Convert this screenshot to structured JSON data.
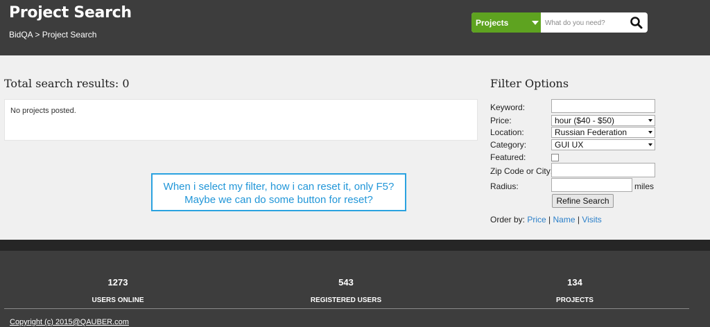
{
  "header": {
    "title": "Project Search",
    "breadcrumb": {
      "home": "BidQA",
      "separator": ">",
      "current": "Project Search"
    }
  },
  "search": {
    "category": "Projects",
    "placeholder": "What do you need?",
    "accent_color": "#5ea320",
    "icon": "search-icon"
  },
  "results": {
    "title": "Total search results: 0",
    "empty_message": "No projects posted."
  },
  "comment": {
    "text": "When i select my filter, how i can reset it, only F5? Maybe we can do some button for reset?",
    "border_color": "#2aa2e0"
  },
  "filter": {
    "title": "Filter Options",
    "keyword": {
      "label": "Keyword:",
      "value": ""
    },
    "price": {
      "label": "Price:",
      "value": "hour ($40 - $50)"
    },
    "location": {
      "label": "Location:",
      "value": "Russian Federation"
    },
    "category": {
      "label": "Category:",
      "value": "GUI UX"
    },
    "featured": {
      "label": "Featured:",
      "checked": false
    },
    "zip": {
      "label": "Zip Code or City:",
      "value": ""
    },
    "radius": {
      "label": "Radius:",
      "value": "",
      "unit": "miles"
    },
    "refine_label": "Refine Search",
    "order_by": {
      "label": "Order by:",
      "options": [
        "Price",
        "Name",
        "Visits"
      ],
      "separator": "|"
    }
  },
  "footer": {
    "stats": [
      {
        "value": "1273",
        "label": "USERS ONLINE"
      },
      {
        "value": "543",
        "label": "REGISTERED USERS"
      },
      {
        "value": "134",
        "label": "PROJECTS"
      }
    ],
    "copyright": "Copyright (c) 2015@QAUBER.com"
  }
}
